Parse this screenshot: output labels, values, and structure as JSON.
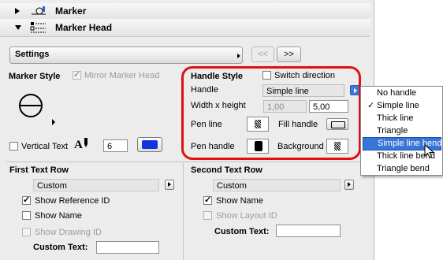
{
  "headers": {
    "marker": "Marker",
    "marker_head": "Marker Head"
  },
  "settings": {
    "label": "Settings",
    "prev": "<<",
    "next": ">>"
  },
  "marker_style": {
    "title": "Marker Style",
    "mirror": "Mirror Marker Head"
  },
  "handle_style": {
    "title": "Handle Style",
    "switch_direction": "Switch direction",
    "handle_label": "Handle",
    "handle_value": "Simple line",
    "width_height_label": "Width x height",
    "width_value": "1,00",
    "height_value": "5,00",
    "pen_line": "Pen line",
    "fill_handle": "Fill handle",
    "pen_handle": "Pen handle",
    "background": "Background"
  },
  "vertical_text": {
    "label": "Vertical Text",
    "value": "6",
    "color": "#1432e0"
  },
  "first_row": {
    "title": "First Text Row",
    "dropdown": "Custom",
    "show_reference_id": "Show Reference ID",
    "show_name": "Show Name",
    "show_drawing_id": "Show Drawing ID",
    "custom_text": "Custom Text:"
  },
  "second_row": {
    "title": "Second Text Row",
    "dropdown": "Custom",
    "show_name": "Show Name",
    "show_layout_id": "Show Layout ID",
    "custom_text": "Custom Text:"
  },
  "handle_menu": {
    "items": [
      "No handle",
      "Simple line",
      "Thick line",
      "Triangle",
      "Simple line bend",
      "Thick line bend",
      "Triangle bend"
    ],
    "checked": "Simple line",
    "highlighted": "Simple line bend"
  }
}
